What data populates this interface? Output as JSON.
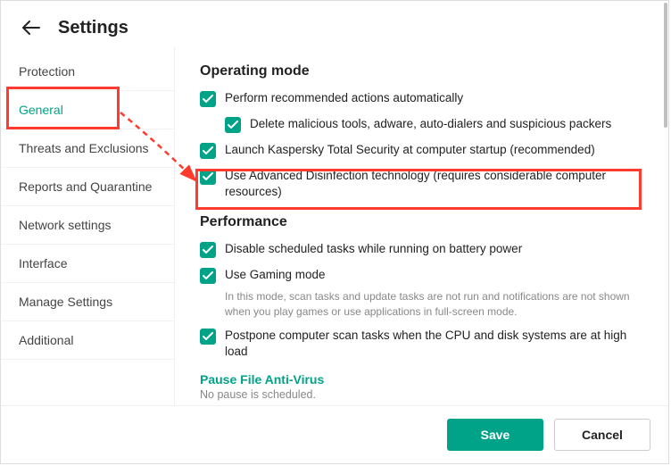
{
  "header": {
    "title": "Settings"
  },
  "sidebar": {
    "items": [
      {
        "label": "Protection"
      },
      {
        "label": "General"
      },
      {
        "label": "Threats and Exclusions"
      },
      {
        "label": "Reports and Quarantine"
      },
      {
        "label": "Network settings"
      },
      {
        "label": "Interface"
      },
      {
        "label": "Manage Settings"
      },
      {
        "label": "Additional"
      }
    ],
    "activeIndex": 1
  },
  "sections": {
    "operating": {
      "title": "Operating mode",
      "items": [
        {
          "label": "Perform recommended actions automatically",
          "checked": true
        },
        {
          "label": "Delete malicious tools, adware, auto-dialers and suspicious packers",
          "checked": true,
          "indent": true
        },
        {
          "label": "Launch Kaspersky Total Security at computer startup (recommended)",
          "checked": true
        },
        {
          "label": "Use Advanced Disinfection technology (requires considerable computer resources)",
          "checked": true
        }
      ]
    },
    "performance": {
      "title": "Performance",
      "items": [
        {
          "label": "Disable scheduled tasks while running on battery power",
          "checked": true
        },
        {
          "label": "Use Gaming mode",
          "checked": true,
          "desc": "In this mode, scan tasks and update tasks are not run and notifications are not shown when you play games or use applications in full-screen mode."
        },
        {
          "label": "Postpone computer scan tasks when the CPU and disk systems are at high load",
          "checked": true
        }
      ]
    },
    "pause": {
      "link": "Pause File Anti-Virus",
      "desc": "No pause is scheduled."
    }
  },
  "footer": {
    "save": "Save",
    "cancel": "Cancel"
  }
}
